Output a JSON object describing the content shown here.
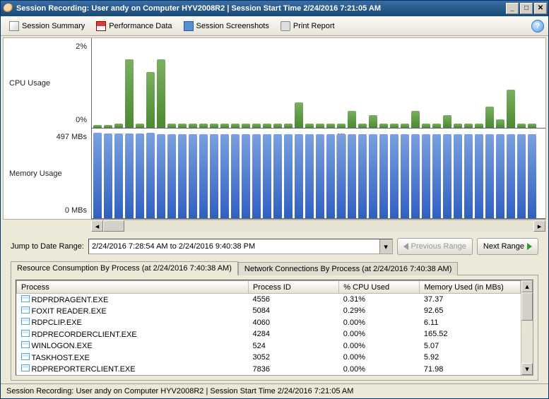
{
  "window": {
    "title": "Session Recording: User andy on Computer HYV2008R2 | Session Start Time 2/24/2016 7:21:05 AM"
  },
  "toolbar": {
    "summary": "Session Summary",
    "perf": "Performance Data",
    "shots": "Session Screenshots",
    "print": "Print Report"
  },
  "chart_data": [
    {
      "type": "bar",
      "title": "CPU Usage",
      "ylabel": "CPU Usage",
      "ylim": [
        0,
        2
      ],
      "ytick_top": "2%",
      "ytick_bottom": "0%",
      "values_pct": [
        0.0,
        0.0,
        0.1,
        1.6,
        0.1,
        1.3,
        1.6,
        0.1,
        0.1,
        0.1,
        0.1,
        0.1,
        0.1,
        0.1,
        0.1,
        0.1,
        0.1,
        0.1,
        0.1,
        0.6,
        0.1,
        0.1,
        0.1,
        0.1,
        0.4,
        0.1,
        0.3,
        0.1,
        0.1,
        0.1,
        0.4,
        0.1,
        0.1,
        0.3,
        0.1,
        0.1,
        0.1,
        0.5,
        0.2,
        0.9,
        0.1,
        0.1
      ]
    },
    {
      "type": "bar",
      "title": "Memory Usage",
      "ylabel": "Memory Usage",
      "ylim": [
        0,
        497
      ],
      "ytick_top": "497 MBs",
      "ytick_bottom": "0 MBs",
      "values_mb": [
        497,
        495,
        495,
        495,
        495,
        497,
        490,
        490,
        490,
        490,
        490,
        490,
        490,
        490,
        490,
        490,
        490,
        490,
        490,
        490,
        490,
        490,
        490,
        490,
        490,
        490,
        490,
        490,
        490,
        490,
        490,
        490,
        490,
        490,
        490,
        490,
        490,
        490,
        490,
        490,
        490,
        490
      ],
      "selected_index": 23
    }
  ],
  "jump": {
    "label": "Jump to Date Range:",
    "value": "2/24/2016 7:28:54 AM to 2/24/2016 9:40:38 PM",
    "prev": "Previous Range",
    "next": "Next Range"
  },
  "tabs": {
    "resource": "Resource Consumption By Process (at 2/24/2016 7:40:38 AM)",
    "network": "Network Connections By Process (at 2/24/2016 7:40:38 AM)"
  },
  "table": {
    "cols": [
      "Process",
      "Process ID",
      "% CPU Used",
      "Memory Used (in MBs)"
    ],
    "rows": [
      {
        "p": "RDPRDRAGENT.EXE",
        "id": "4556",
        "cpu": "0.31%",
        "mem": "37.37"
      },
      {
        "p": "FOXIT READER.EXE",
        "id": "5084",
        "cpu": "0.29%",
        "mem": "92.65"
      },
      {
        "p": "RDPCLIP.EXE",
        "id": "4060",
        "cpu": "0.00%",
        "mem": "6.11"
      },
      {
        "p": "RDPRECORDERCLIENT.EXE",
        "id": "4284",
        "cpu": "0.00%",
        "mem": "165.52"
      },
      {
        "p": "WINLOGON.EXE",
        "id": "524",
        "cpu": "0.00%",
        "mem": "5.07"
      },
      {
        "p": "TASKHOST.EXE",
        "id": "3052",
        "cpu": "0.00%",
        "mem": "5.92"
      },
      {
        "p": "RDPREPORTERCLIENT.EXE",
        "id": "7836",
        "cpu": "0.00%",
        "mem": "71.98"
      }
    ]
  },
  "status": "Session Recording: User andy on Computer HYV2008R2 | Session Start Time 2/24/2016 7:21:05 AM"
}
